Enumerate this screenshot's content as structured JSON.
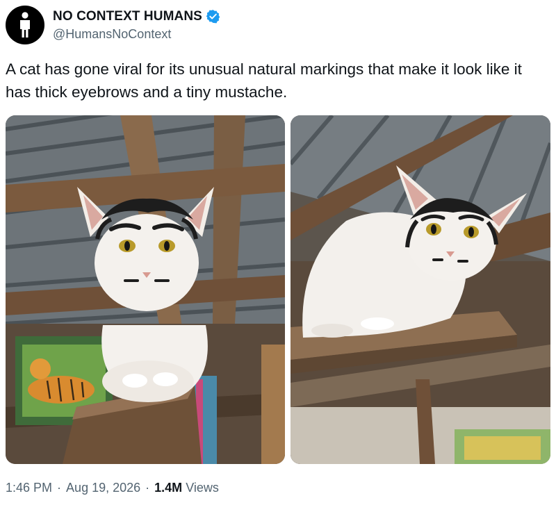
{
  "tweet": {
    "author": {
      "display_name": "NO CONTEXT HUMANS",
      "handle": "@HumansNoContext",
      "verified": true,
      "verified_color": "#1d9bf0",
      "avatar_icon": "person-standing-icon"
    },
    "text": "A cat has gone viral for its unusual natural markings that make it look like it has thick eyebrows and a tiny mustache.",
    "media": [
      {
        "kind": "photo",
        "subject": "white-cat-on-wooden-post"
      },
      {
        "kind": "photo",
        "subject": "white-cat-on-wooden-shelf"
      }
    ],
    "meta": {
      "time": "1:46 PM",
      "separator": "·",
      "date": "Aug 19, 2026",
      "views_count": "1.4M",
      "views_label": "Views"
    }
  },
  "colors": {
    "text_primary": "#0f1419",
    "text_secondary": "#536471",
    "background": "#ffffff"
  }
}
